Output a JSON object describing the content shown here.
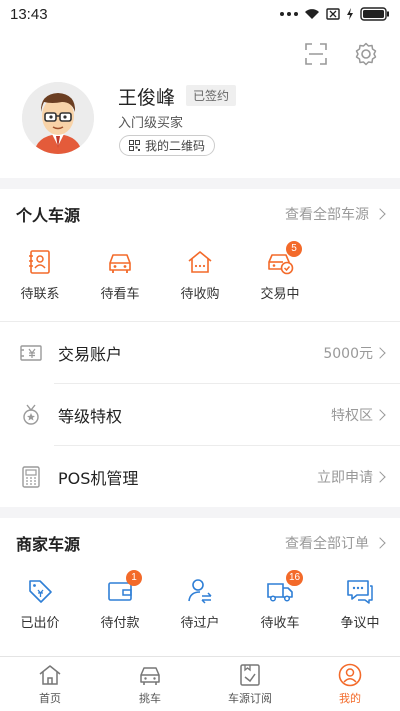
{
  "status": {
    "time": "13:43"
  },
  "profile": {
    "name": "王俊峰",
    "sign_badge": "已签约",
    "level": "入门级买家",
    "qr_label": "我的二维码"
  },
  "personal": {
    "title": "个人车源",
    "link": "查看全部车源",
    "items": [
      {
        "label": "待联系",
        "icon": "contact-card-icon"
      },
      {
        "label": "待看车",
        "icon": "car-icon"
      },
      {
        "label": "待收购",
        "icon": "house-icon"
      },
      {
        "label": "交易中",
        "icon": "car-check-icon",
        "badge": "5"
      }
    ]
  },
  "menu": [
    {
      "label": "交易账户",
      "value": "5000元",
      "icon": "yuan-card-icon"
    },
    {
      "label": "等级特权",
      "value": "特权区",
      "icon": "medal-icon"
    },
    {
      "label": "POS机管理",
      "value": "立即申请",
      "icon": "pos-icon"
    }
  ],
  "merchant": {
    "title": "商家车源",
    "link": "查看全部订单",
    "items": [
      {
        "label": "已出价",
        "icon": "price-tag-icon"
      },
      {
        "label": "待付款",
        "icon": "wallet-icon",
        "badge": "1"
      },
      {
        "label": "待过户",
        "icon": "transfer-user-icon"
      },
      {
        "label": "待收车",
        "icon": "truck-icon",
        "badge": "16"
      },
      {
        "label": "争议中",
        "icon": "chat-icon"
      }
    ]
  },
  "nav": [
    {
      "label": "首页",
      "icon": "home-icon"
    },
    {
      "label": "挑车",
      "icon": "car-front-icon"
    },
    {
      "label": "车源订阅",
      "icon": "subscribe-icon"
    },
    {
      "label": "我的",
      "icon": "user-circle-icon",
      "active": true
    }
  ],
  "colors": {
    "accent": "#f36a2a",
    "blue": "#2f7fd6"
  }
}
